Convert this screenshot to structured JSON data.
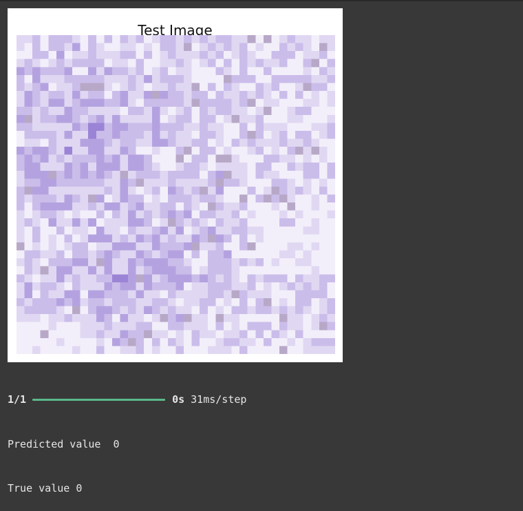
{
  "figure": {
    "title": "Test Image",
    "image": {
      "grid_size": 40,
      "palette": [
        "#f2effa",
        "#e0d8f2",
        "#cbbdea",
        "#b4a2e0",
        "#9b84d5",
        "#b8a8c8"
      ]
    }
  },
  "output": {
    "progress": {
      "count": "1/1",
      "fraction": 1.0,
      "elapsed": "0s",
      "rate": "31ms/step",
      "bar_color": "#5bb98c"
    },
    "predicted_line": "Predicted value  0",
    "true_line": "True value 0"
  }
}
